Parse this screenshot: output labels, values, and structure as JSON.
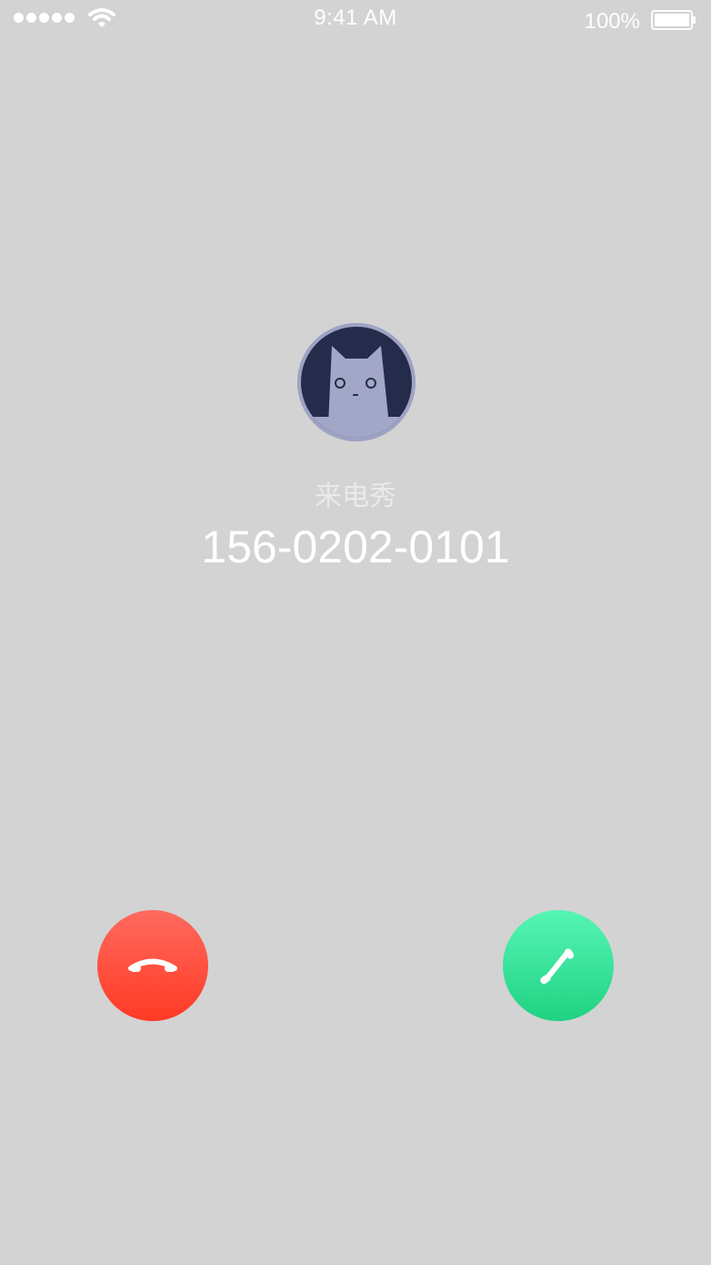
{
  "status_bar": {
    "time": "9:41 AM",
    "battery_percent": "100%",
    "signal_icon": "signal-dots-icon",
    "wifi_icon": "wifi-icon",
    "battery_icon": "battery-icon"
  },
  "caller": {
    "label": "来电秀",
    "number": "156-0202-0101",
    "avatar_icon": "cat-avatar-icon"
  },
  "actions": {
    "decline_icon": "phone-hangup-icon",
    "accept_icon": "phone-answer-icon"
  },
  "colors": {
    "background": "#d3d3d3",
    "decline": "#ff4b3c",
    "accept": "#35e19a",
    "avatar_bg": "#252b4b",
    "avatar_cat": "#9ea2c4"
  }
}
